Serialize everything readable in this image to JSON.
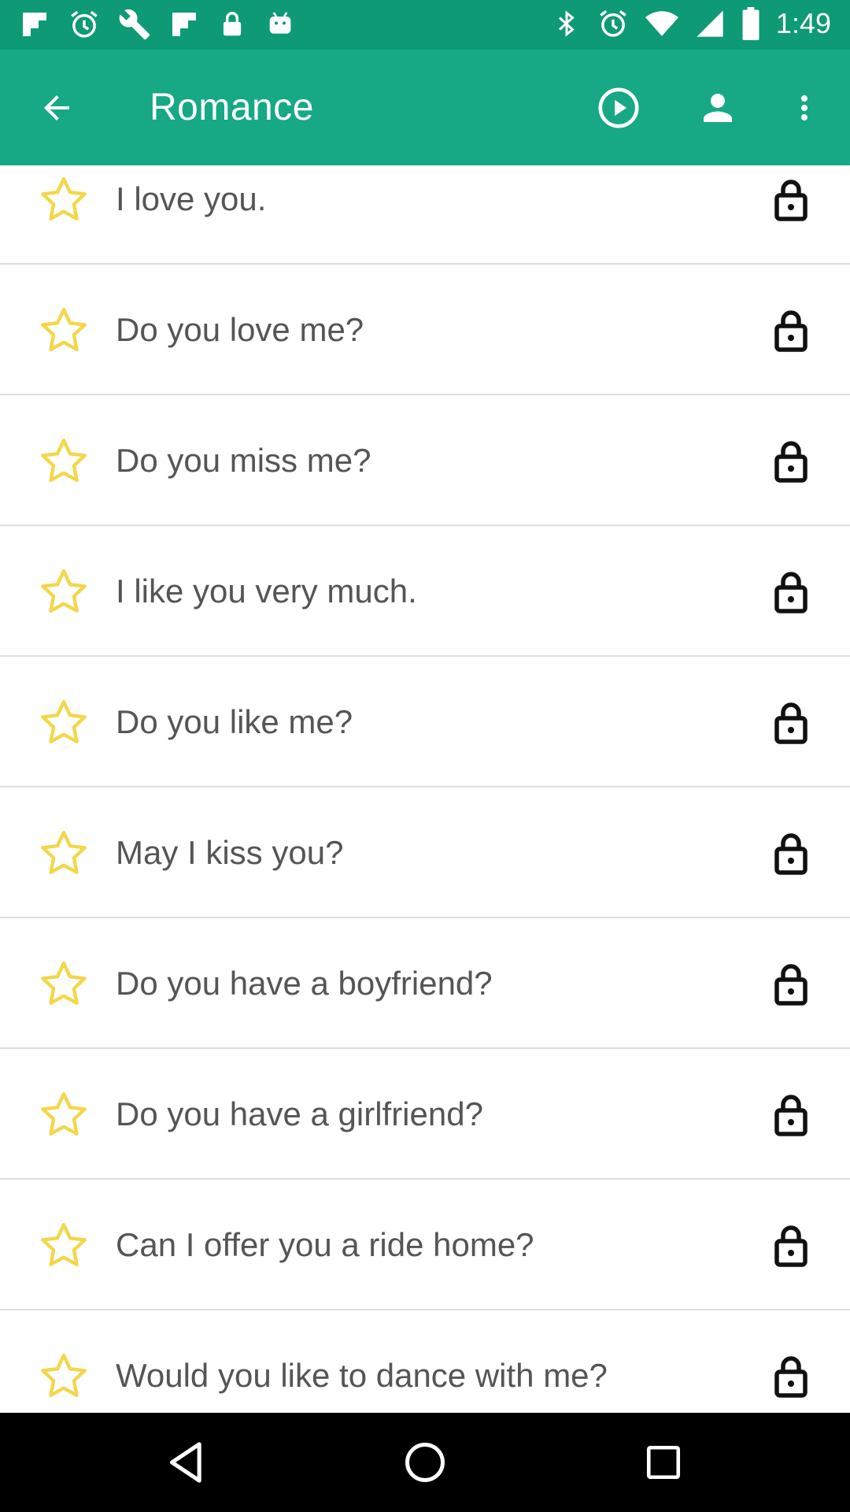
{
  "status_bar": {
    "time": "1:49",
    "left_icons": [
      "flipboard-icon",
      "alarm-icon",
      "wrench-icon",
      "flipboard-icon",
      "lock-icon",
      "android-icon"
    ],
    "right_icons": [
      "bluetooth-icon",
      "alarm-icon",
      "wifi-icon",
      "signal-icon",
      "battery-icon"
    ]
  },
  "app_bar": {
    "title": "Romance",
    "back_icon": "arrow-back-icon",
    "actions": [
      "play-circle-icon",
      "account-icon",
      "more-vert-icon"
    ]
  },
  "colors": {
    "status_bar": "#0d9a74",
    "app_bar": "#17a886",
    "star": "#f2d74a",
    "text": "#555555",
    "divider": "#dedede"
  },
  "phrases": [
    {
      "text": "I love you."
    },
    {
      "text": "Do you love me?"
    },
    {
      "text": "Do you miss me?"
    },
    {
      "text": "I like you very much."
    },
    {
      "text": "Do you like me?"
    },
    {
      "text": "May I kiss you?"
    },
    {
      "text": "Do you have a boyfriend?"
    },
    {
      "text": "Do you have a girlfriend?"
    },
    {
      "text": "Can I offer you a ride home?"
    },
    {
      "text": "Would you like to dance with me?"
    }
  ],
  "nav_bar": {
    "buttons": [
      "nav-back-icon",
      "nav-home-icon",
      "nav-recents-icon"
    ]
  }
}
